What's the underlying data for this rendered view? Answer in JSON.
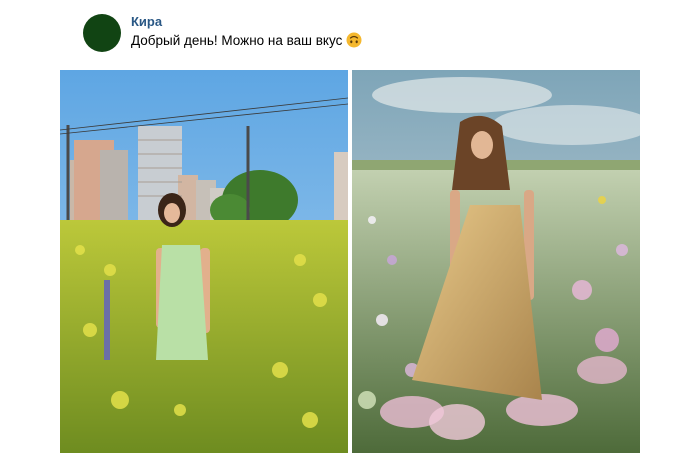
{
  "post": {
    "author": "Кира",
    "message": "Добрый день! Можно на ваш вкус",
    "emoji_icon": "upside-down-face-icon"
  },
  "photos": [
    {
      "icon": "photo-girl-green-dress-in-yellow-field"
    },
    {
      "icon": "photo-girl-gold-dress-in-flower-meadow"
    }
  ],
  "colors": {
    "author_link": "#2a5885",
    "avatar": "#114413",
    "emoji": "#f5b82e"
  }
}
